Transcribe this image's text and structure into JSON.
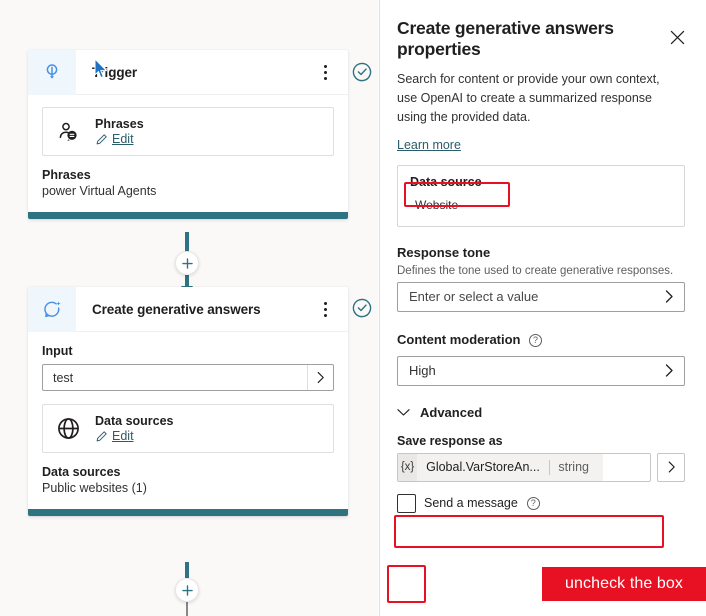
{
  "canvas": {
    "trigger_node": {
      "icon": "trigger-pin-icon",
      "title": "Trigger",
      "subcard": {
        "icon": "person-chat-icon",
        "title": "Phrases",
        "edit_label": "Edit"
      },
      "summary_key": "Phrases",
      "summary_value": "power Virtual Agents"
    },
    "action_node": {
      "icon": "generative-answers-icon",
      "title": "Create generative answers",
      "input_label": "Input",
      "input_value": "test",
      "subcard": {
        "icon": "globe-icon",
        "title": "Data sources",
        "edit_label": "Edit"
      },
      "summary_key": "Data sources",
      "summary_value": "Public websites (1)"
    },
    "add_button_label": "+",
    "status_icon": "check-circle-icon"
  },
  "panel": {
    "title": "Create generative answers properties",
    "close_icon": "close-icon",
    "description": "Search for content or provide your own context, use OpenAI to create a summarized response using the provided data.",
    "learn_more": "Learn more",
    "data_source_card": {
      "title": "Data source",
      "value": "Website"
    },
    "response_tone": {
      "label": "Response tone",
      "help": "Defines the tone used to create generative responses.",
      "placeholder": "Enter or select a value",
      "chevron_icon": "chevron-right-icon"
    },
    "content_moderation": {
      "label": "Content moderation",
      "info_icon": "info-icon",
      "value": "High",
      "chevron_icon": "chevron-right-icon"
    },
    "advanced": {
      "label": "Advanced",
      "chevron_icon": "chevron-down-icon",
      "save_response_label": "Save response as",
      "variable_token": "{x}",
      "variable_name": "Global.VarStoreAn...",
      "variable_type": "string",
      "chevron_right_icon": "chevron-right-icon",
      "send_message_label": "Send a message",
      "send_message_info_icon": "info-icon",
      "send_message_checked": false
    }
  },
  "annotations": {
    "callout_text": "uncheck the box",
    "highlight_color": "#e81123"
  }
}
